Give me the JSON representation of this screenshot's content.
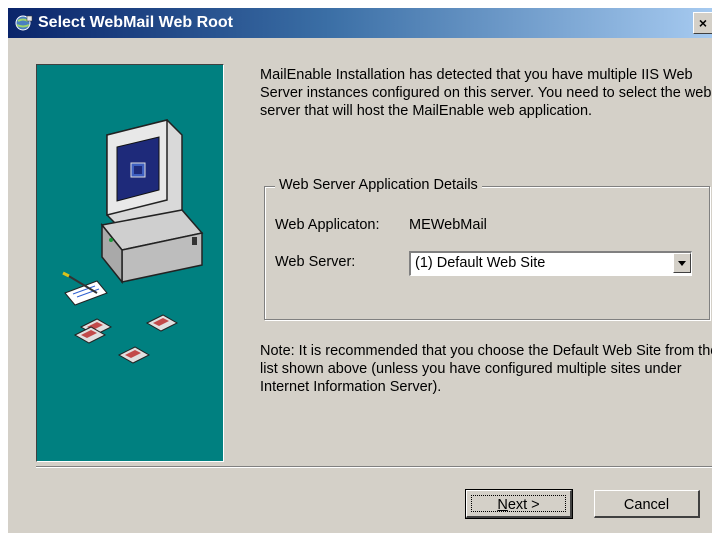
{
  "window": {
    "title": "Select WebMail Web Root",
    "close_label": "×"
  },
  "intro_text": "MailEnable Installation has detected that you have multiple IIS Web Server instances configured on this server. You need to select the web server that will host the MailEnable web application.",
  "group": {
    "legend": "Web Server Application Details",
    "app_label": "Web Applicaton:",
    "app_value": "MEWebMail",
    "server_label": "Web Server:",
    "server_value": "(1) Default Web Site"
  },
  "note_text": "Note: It is recommended that you choose the Default Web Site from the list shown above (unless you have configured multiple sites under Internet Information Server).",
  "buttons": {
    "next_mnemonic": "N",
    "next_rest": "ext >",
    "cancel": "Cancel"
  },
  "colors": {
    "panel_bg": "#008080",
    "dialog_bg": "#d4d0c8",
    "title_start": "#0a246a",
    "title_end": "#a6caf0"
  },
  "icons": [
    "installer-globe-icon",
    "computer-illustration",
    "floppy-disk-icon",
    "combo-dropdown-arrow-icon"
  ]
}
